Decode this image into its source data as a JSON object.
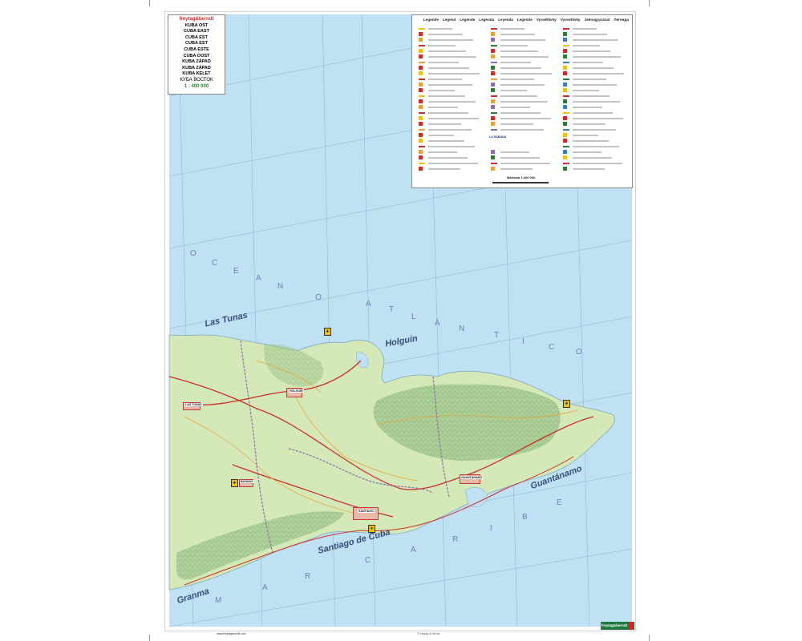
{
  "publisher": {
    "brand": "freytag&berndt",
    "logo_text": "freytag&berndt"
  },
  "title_box": {
    "titles": [
      "KUBA OST",
      "CUBA EAST",
      "CUBA EST",
      "CUBA EST",
      "CUBA ESTE",
      "CUBA OOST",
      "KUBA ZÁPAD",
      "KUBA ZÁPAD",
      "KUBA KELET"
    ],
    "title_ru": "КУБА ВОСТОК",
    "scale": "1 : 400 000"
  },
  "legend": {
    "headings": [
      "Legende",
      "Legend",
      "Légende",
      "Legenda",
      "Leyenda",
      "Legende",
      "Vysvětlivky",
      "Vysvetlivky",
      "Jelmagyarázat",
      "Легенда"
    ],
    "scale_label": "Maßstab 1:400 000",
    "inset_label": "LA HABANA"
  },
  "map": {
    "region_labels": [
      "Las Tunas",
      "Holguín",
      "Guantánamo",
      "Santiago de Cuba",
      "Granma"
    ],
    "ocean_letters": [
      "O",
      "C",
      "E",
      "A",
      "N",
      "O",
      "A",
      "T",
      "L",
      "Á",
      "N",
      "T",
      "I",
      "C",
      "O"
    ],
    "sea_letters": [
      "M",
      "A",
      "R",
      "C",
      "A",
      "R",
      "I",
      "B",
      "E"
    ],
    "cities": [
      "HOLGUÍN",
      "LAS TUNAS",
      "BAYAMO",
      "SANTIAGO",
      "GUANTÁNAMO"
    ],
    "colors": {
      "sea": "#bfe1f3",
      "land_low": "#d5e8b8",
      "land_high": "#9cc287",
      "roads": "#c8302c",
      "border": "#8b6fa8"
    }
  },
  "footer": {
    "url": "www.freytagberndt.com",
    "copyright": "© freytag & berndt"
  }
}
